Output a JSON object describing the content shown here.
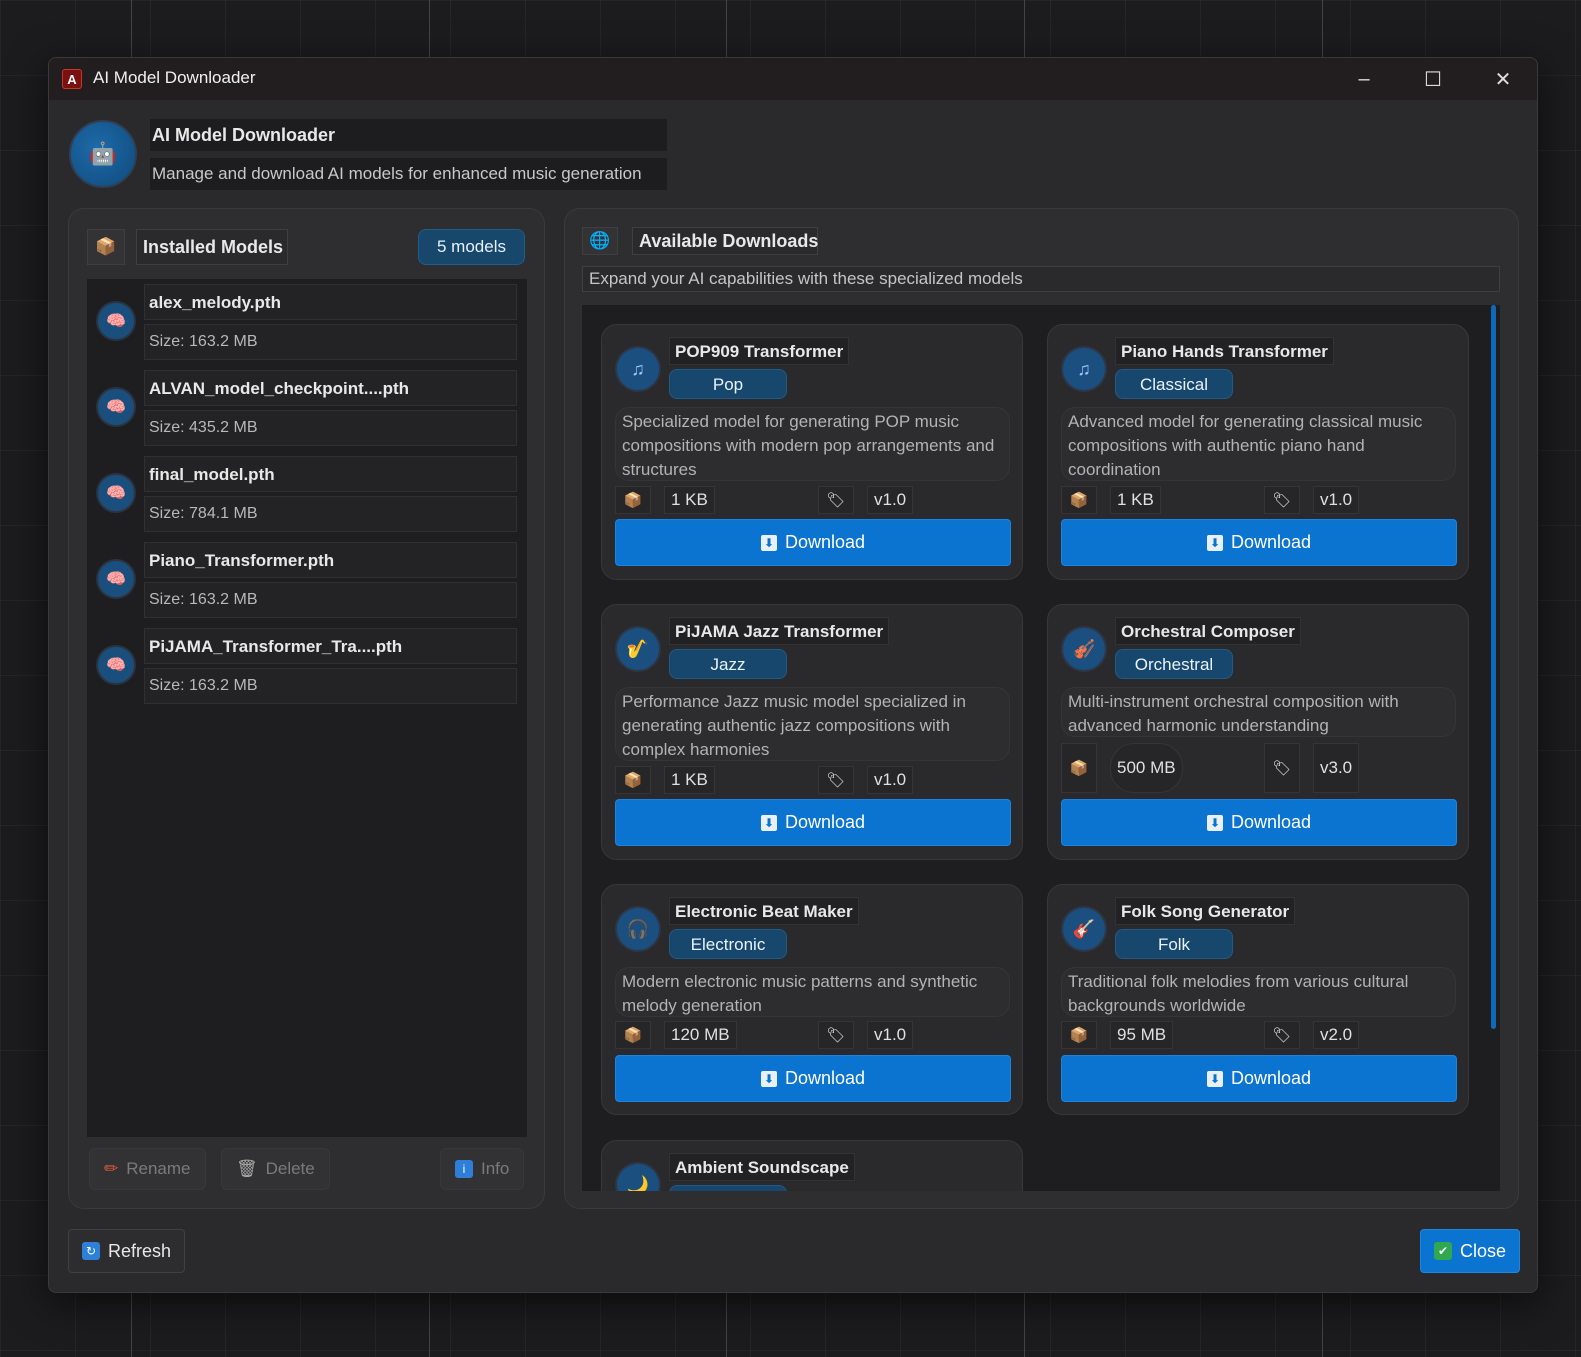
{
  "window": {
    "title": "AI Model Downloader",
    "app_icon": "app-logo-icon",
    "controls": {
      "minimize": "–",
      "maximize": "☐",
      "close": "✕"
    }
  },
  "header": {
    "icon": "robot-icon",
    "title": "AI Model Downloader",
    "subtitle": "Manage and download AI models for enhanced music generation"
  },
  "installed": {
    "icon": "package-icon",
    "title": "Installed Models",
    "count": "5 models",
    "models": [
      {
        "name": "alex_melody.pth",
        "size": "Size: 163.2 MB"
      },
      {
        "name": "ALVAN_model_checkpoint....pth",
        "size": "Size: 435.2 MB"
      },
      {
        "name": "final_model.pth",
        "size": "Size: 784.1 MB"
      },
      {
        "name": "Piano_Transformer.pth",
        "size": "Size: 163.2 MB"
      },
      {
        "name": "PiJAMA_Transformer_Tra....pth",
        "size": "Size: 163.2 MB"
      }
    ],
    "actions": {
      "rename": "Rename",
      "delete": "Delete",
      "info": "Info"
    }
  },
  "available": {
    "icon": "globe-icon",
    "title": "Available Downloads",
    "subtitle": "Expand your AI capabilities with these specialized models",
    "download_label": "Download",
    "cards": [
      {
        "title": "POP909 Transformer",
        "genre": "Pop",
        "icon": "music-note-icon",
        "glyph": "♫",
        "desc": "Specialized model for generating POP music compositions with modern pop arrangements and structures",
        "size": "1 KB",
        "version": "v1.0"
      },
      {
        "title": "Piano Hands Transformer",
        "genre": "Classical",
        "icon": "music-note-icon",
        "glyph": "♫",
        "desc": "Advanced model for generating classical music compositions with authentic piano hand coordination",
        "size": "1 KB",
        "version": "v1.0"
      },
      {
        "title": "PiJAMA Jazz Transformer",
        "genre": "Jazz",
        "icon": "saxophone-icon",
        "glyph": "🎷",
        "desc": "Performance Jazz music model specialized in generating authentic jazz compositions with complex harmonies",
        "size": "1 KB",
        "version": "v1.0"
      },
      {
        "title": "Orchestral Composer",
        "genre": "Orchestral",
        "icon": "violin-icon",
        "glyph": "🎻",
        "desc": "Multi-instrument orchestral composition with advanced harmonic understanding",
        "size": "500 MB",
        "version": "v3.0"
      },
      {
        "title": "Electronic Beat Maker",
        "genre": "Electronic",
        "icon": "headphones-icon",
        "glyph": "🎧",
        "desc": "Modern electronic music patterns and synthetic melody generation",
        "size": "120 MB",
        "version": "v1.0"
      },
      {
        "title": "Folk Song Generator",
        "genre": "Folk",
        "icon": "guitar-icon",
        "glyph": "🎸",
        "desc": "Traditional folk melodies from various cultural backgrounds worldwide",
        "size": "95 MB",
        "version": "v2.0"
      },
      {
        "title": "Ambient Soundscape",
        "genre": "",
        "icon": "moon-icon",
        "glyph": "🌙",
        "desc": "",
        "size": "",
        "version": ""
      }
    ]
  },
  "footer": {
    "refresh": "Refresh",
    "close": "Close"
  },
  "colors": {
    "accent": "#0b74d1",
    "badge": "#17476b",
    "window_bg": "#2a2a2c",
    "list_bg": "#1e1e20"
  }
}
